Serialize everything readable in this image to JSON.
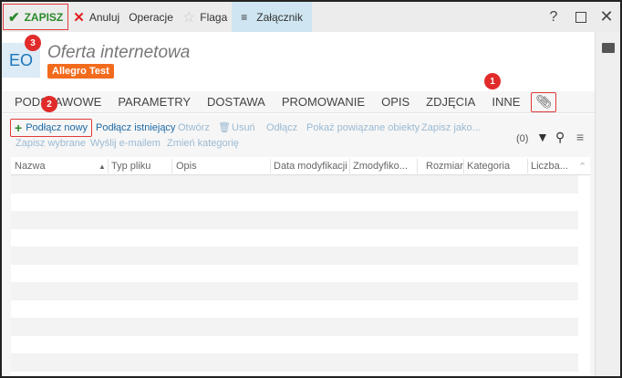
{
  "toolbar": {
    "save": "ZAPISZ",
    "cancel": "Anuluj",
    "operations": "Operacje",
    "flag": "Flaga",
    "attachment": "Załącznik",
    "help": "?"
  },
  "header": {
    "avatar": "EO",
    "title": "Oferta internetowa",
    "badge": "Allegro Test"
  },
  "tabs": [
    "PODSTAWOWE",
    "PARAMETRY",
    "DOSTAWA",
    "PROMOWANIE",
    "OPIS",
    "ZDJĘCIA",
    "INNE"
  ],
  "actions": {
    "attach_new": "Podłącz nowy",
    "attach_existing": "Podłącz istniejący",
    "open": "Otwórz",
    "delete": "Usuń",
    "detach": "Odłącz",
    "show_related": "Pokaż powiązane obiekty",
    "save_as": "Zapisz jako...",
    "save_selected": "Zapisz wybrane",
    "send_email": "Wyślij e-mailem",
    "change_category": "Zmień kategorię",
    "count": "(0)"
  },
  "table": {
    "columns": [
      "Nazwa",
      "Typ pliku",
      "Opis",
      "Data modyfikacji",
      "Zmodyfiko...",
      "Rozmiar",
      "Kategoria",
      "Liczba..."
    ]
  },
  "markers": [
    "1",
    "2",
    "3"
  ]
}
